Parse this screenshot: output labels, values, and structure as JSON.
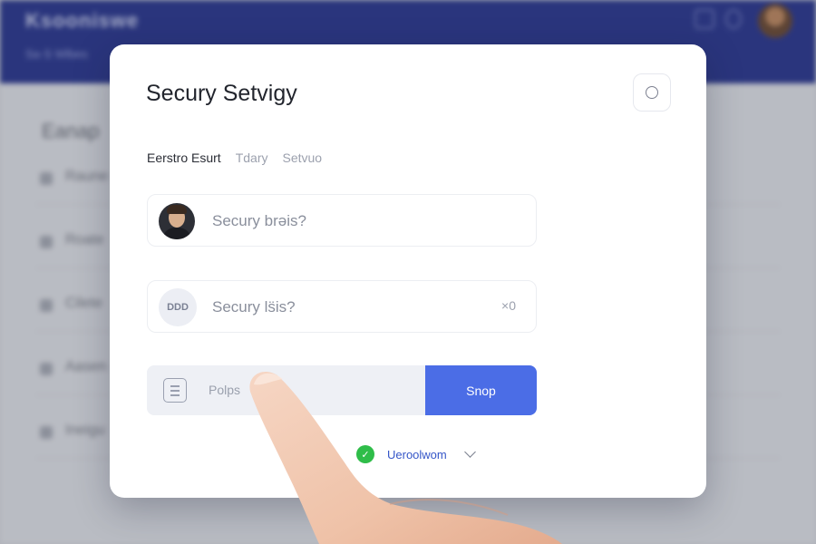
{
  "background_app": {
    "brand": "Ksooniswe",
    "subnav": "Sa·S Wlbes",
    "section_title": "Eanap",
    "rows": [
      "Raune",
      "Roate",
      "Cilete",
      "Aasen",
      "Ineigu"
    ]
  },
  "modal": {
    "title": "Secury Setvigy",
    "close_icon": "circle-icon",
    "tabs": [
      {
        "label": "Eerstro Esurt",
        "active": true
      },
      {
        "label": "Tdary",
        "active": false
      },
      {
        "label": "Setvuo",
        "active": false
      }
    ],
    "field_1": {
      "text": "Secury brəis?",
      "icon": "avatar"
    },
    "field_2": {
      "text": "Secury ls̈is?",
      "badge": "DDD",
      "clear": "×0"
    },
    "search": {
      "placeholder": "Polps",
      "icon": "document-icon"
    },
    "submit_label": "Snop",
    "status": {
      "text": "Ueroolwom",
      "icon": "check-icon"
    }
  },
  "colors": {
    "header": "#2b3890",
    "accent": "#4b6de6",
    "success": "#2fbd49",
    "status_text": "#3556c8"
  }
}
